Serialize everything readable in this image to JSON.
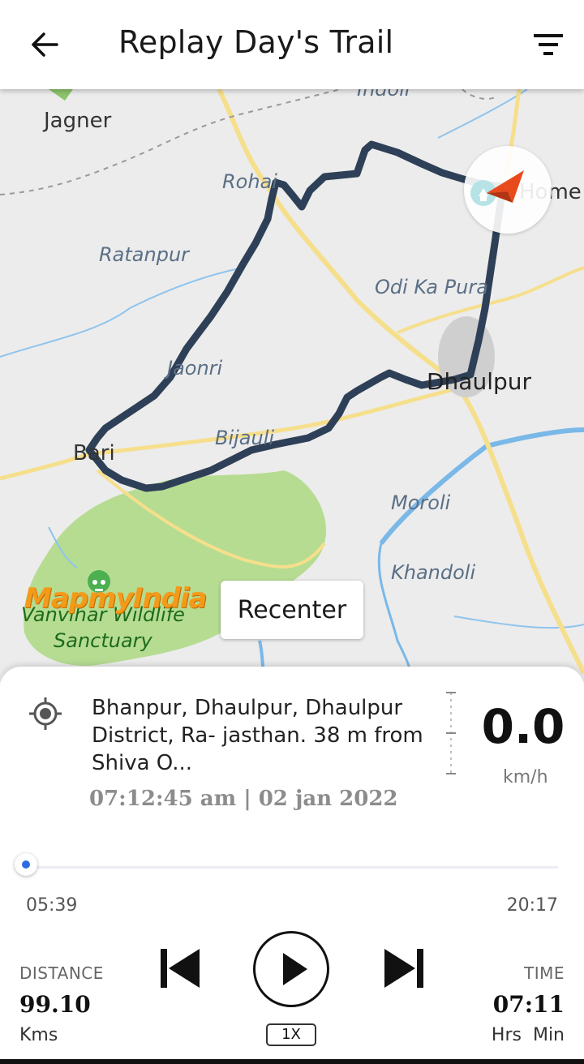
{
  "header": {
    "title": "Replay Day's Trail",
    "back_icon": "arrow-left-icon",
    "filter_icon": "filter-icon"
  },
  "map": {
    "places": {
      "jagner": "Jagner",
      "indoli": "Indoli",
      "rohai": "Rohai",
      "home": "Home",
      "ratanpur": "Ratanpur",
      "odi_ka_pura": "Odi Ka Pura",
      "jaonri": "Jaonri",
      "dhaulpur": "Dhaulpur",
      "bijauli": "Bijauli",
      "bari": "Bari",
      "moroli": "Moroli",
      "khandoli": "Khandoli",
      "sanctuary_line1": "Vanvihar Wildlife",
      "sanctuary_line2": "Sanctuary"
    },
    "logo": "MapmyIndia",
    "recenter_label": "Recenter",
    "route_color": "#2e4057"
  },
  "info": {
    "address": "Bhanpur, Dhaulpur, Dhaulpur District, Ra- jasthan. 38 m from Shiva O...",
    "timestamp": "07:12:45 am | 02 jan 2022",
    "speed_value": "0.0",
    "speed_unit": "km/h"
  },
  "playback": {
    "start_time": "05:39",
    "end_time": "20:17",
    "progress": 0.0,
    "speed_label": "1X"
  },
  "stats": {
    "distance_label": "DISTANCE",
    "distance_value": "99.10",
    "distance_unit": "Kms",
    "time_label": "TIME",
    "time_value": "07:11",
    "time_unit": "Hrs  Min"
  }
}
